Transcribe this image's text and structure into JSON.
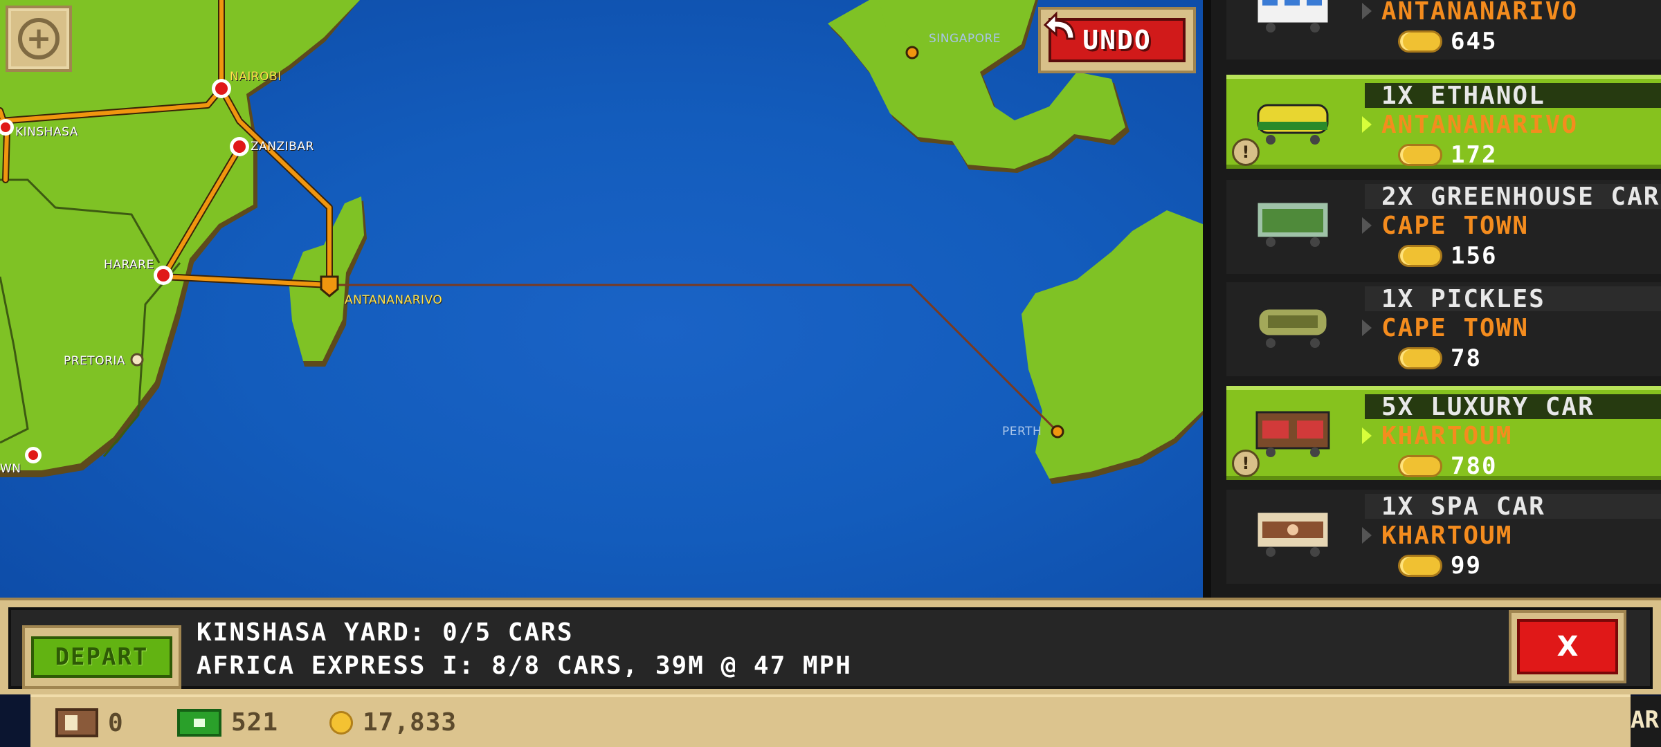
{
  "map": {
    "cities": [
      {
        "id": "nairobi",
        "name": "NAIROBI",
        "style": "yellow"
      },
      {
        "id": "kinshasa",
        "name": "KINSHASA",
        "style": "white"
      },
      {
        "id": "zanzibar",
        "name": "ZANZIBAR",
        "style": "white"
      },
      {
        "id": "harare",
        "name": "HARARE",
        "style": "white"
      },
      {
        "id": "antananarivo",
        "name": "ANTANANARIVO",
        "style": "yellow"
      },
      {
        "id": "pretoria",
        "name": "PRETORIA",
        "style": "white"
      },
      {
        "id": "capetown_partial",
        "name": "WN",
        "style": "white"
      },
      {
        "id": "perth",
        "name": "PERTH",
        "style": "dim"
      },
      {
        "id": "singapore",
        "name": "SINGAPORE",
        "style": "dim"
      }
    ],
    "zoom_label": "+",
    "undo_label": "UNDO"
  },
  "cargo_list": [
    {
      "title": "",
      "destination": "ANTANANARIVO",
      "payout": "645",
      "selected": false,
      "car": "passenger-car",
      "alert": false
    },
    {
      "title": "1X ETHANOL",
      "destination": "ANTANANARIVO",
      "payout": "172",
      "selected": true,
      "car": "ethanol-tanker",
      "alert": true
    },
    {
      "title": "2X GREENHOUSE CAR",
      "destination": "CAPE TOWN",
      "payout": "156",
      "selected": false,
      "car": "greenhouse-car",
      "alert": false
    },
    {
      "title": "1X PICKLES",
      "destination": "CAPE TOWN",
      "payout": "78",
      "selected": false,
      "car": "pickles-tanker",
      "alert": false
    },
    {
      "title": "5X LUXURY CAR",
      "destination": "KHARTOUM",
      "payout": "780",
      "selected": true,
      "car": "luxury-car",
      "alert": true
    },
    {
      "title": "1X SPA CAR",
      "destination": "KHARTOUM",
      "payout": "99",
      "selected": false,
      "car": "spa-car",
      "alert": false
    }
  ],
  "info_bar": {
    "depart_label": "DEPART",
    "line1": "KINSHASA YARD: 0/5 CARS",
    "line2": "AFRICA EXPRESS I: 8/8 CARS, 39M @ 47 MPH",
    "close_label": "X"
  },
  "status_bar": {
    "cars": "0",
    "bux": "521",
    "coins": "17,833",
    "edge_text": "AR"
  },
  "colors": {
    "ocean": "#135cbc",
    "land": "#7fc225",
    "track": "#f0960f",
    "selected_row": "#86c21e",
    "destination_text": "#f48c1e"
  }
}
